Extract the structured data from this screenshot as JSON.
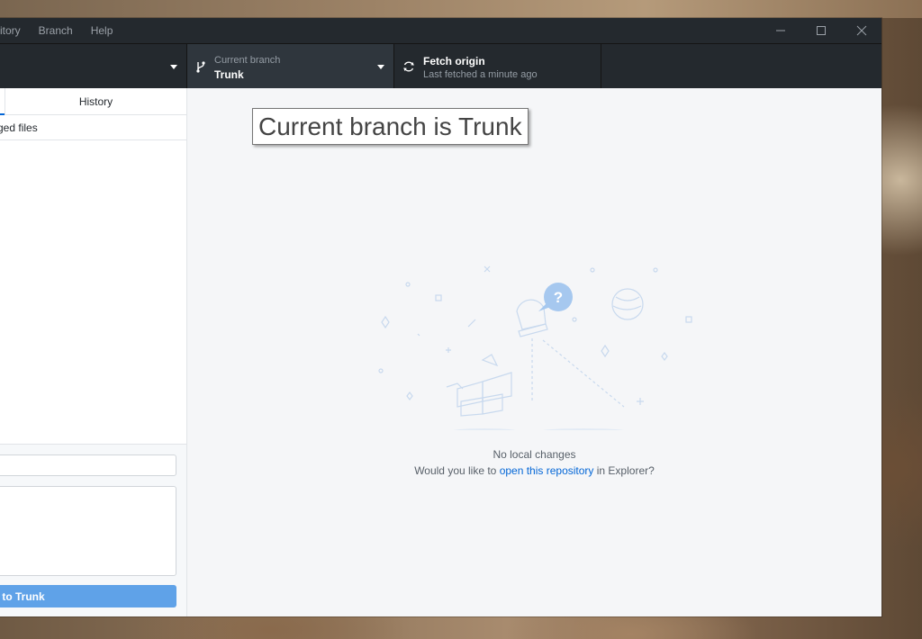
{
  "menu": {
    "repository": "sitory",
    "branch": "Branch",
    "help": "Help"
  },
  "toolbar": {
    "branch_label": "Current branch",
    "branch_value": "Trunk",
    "fetch_label": "Fetch origin",
    "fetch_status": "Last fetched a minute ago"
  },
  "sidebar": {
    "tab_history": "History",
    "changed_files": "ged files",
    "commit_button": "t to Trunk"
  },
  "main": {
    "tooltip": "Current branch is Trunk",
    "no_changes": "No local changes",
    "suggest_prefix": "Would you like to ",
    "suggest_link": "open this repository",
    "suggest_suffix": " in Explorer?"
  },
  "icons": {
    "branch": "branch-icon",
    "sync": "sync-icon",
    "minimize": "minimize-icon",
    "maximize": "maximize-icon",
    "close": "close-icon"
  },
  "colors": {
    "titlebar": "#24292e",
    "accent": "#0366d6",
    "commit_button": "#5fa2e8",
    "main_bg": "#f5f6f8"
  }
}
